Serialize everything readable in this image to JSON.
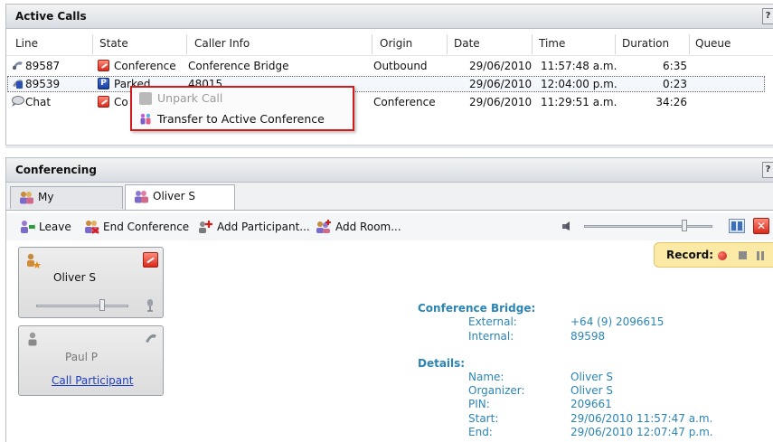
{
  "active_calls": {
    "title": "Active Calls",
    "help_icon": "?",
    "columns": [
      "Line",
      "State",
      "Caller Info",
      "Origin",
      "Date",
      "Time",
      "Duration",
      "Queue"
    ],
    "rows": [
      {
        "line": "89587",
        "state": "Conference",
        "caller_info": "Conference Bridge",
        "origin": "Outbound",
        "date": "29/06/2010",
        "time": "11:57:48 a.m.",
        "duration": "6:35",
        "queue": ""
      },
      {
        "line": "89539",
        "state": "Parked",
        "caller_info": "48015",
        "origin": "",
        "date": "29/06/2010",
        "time": "12:04:00 p.m.",
        "duration": "0:23",
        "queue": ""
      },
      {
        "line": "Chat",
        "state": "Co",
        "caller_info": "",
        "origin": "Conference",
        "date": "29/06/2010",
        "time": "11:29:51 a.m.",
        "duration": "34:26",
        "queue": ""
      }
    ]
  },
  "context_menu": {
    "items": [
      {
        "label": "Unpark Call",
        "enabled": false
      },
      {
        "label": "Transfer to Active Conference",
        "enabled": true
      }
    ]
  },
  "conferencing": {
    "title": "Conferencing",
    "help_icon": "?",
    "tabs": [
      {
        "label": "My Conferences",
        "active": false
      },
      {
        "label": "Oliver S",
        "active": true
      }
    ],
    "toolbar": {
      "leave": "Leave",
      "end_conference": "End Conference",
      "add_participant": "Add Participant...",
      "add_room": "Add Room...",
      "volume_level": 0.78
    },
    "record": {
      "label": "Record:"
    },
    "participants": [
      {
        "name": "Oliver S",
        "volume_level": 0.72
      },
      {
        "name": "Paul P",
        "action": "Call Participant"
      }
    ],
    "bridge": {
      "heading": "Conference Bridge:",
      "external_label": "External:",
      "external_value": "+64 (9)  2096615",
      "internal_label": "Internal:",
      "internal_value": "89598"
    },
    "details": {
      "heading": "Details:",
      "name_label": "Name:",
      "name_value": "Oliver S",
      "organizer_label": "Organizer:",
      "organizer_value": "Oliver S",
      "pin_label": "PIN:",
      "pin_value": "209661",
      "start_label": "Start:",
      "start_value": "29/06/2010 11:57:47 a.m.",
      "end_label": "End:",
      "end_value": "29/06/2010 12:07:47 p.m."
    }
  },
  "colors": {
    "accent_blue": "#2a85b5",
    "menu_highlight": "#d21b1b",
    "record_bg": "#fbe9a6"
  }
}
